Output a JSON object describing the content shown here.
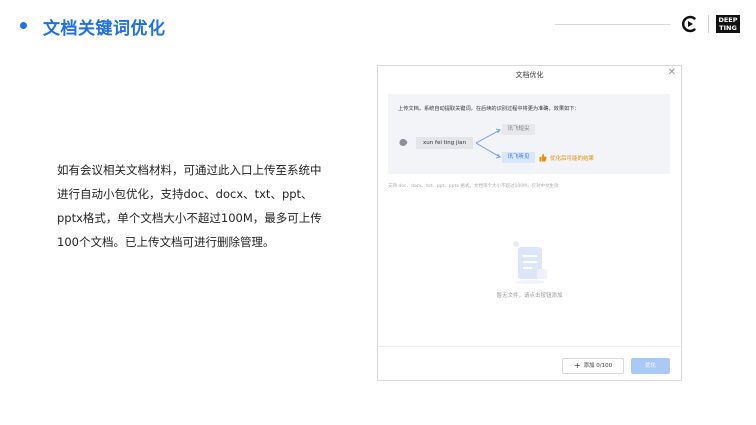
{
  "page": {
    "title": "文档关键词优化",
    "brand_logo_lines": [
      "DEEP",
      "TING"
    ]
  },
  "description": [
    "如有会议相关文档材料，可通过此入口上传至系统中",
    "进行自动小包优化，支持doc、docx、txt、ppt、",
    "pptx格式，单个文档大小不超过100M，最多可上传",
    "100个文档。已上传文档可进行删除管理。"
  ],
  "dialog": {
    "title": "文档优化",
    "close_symbol": "✕",
    "info_text": "上传文档，系统自动提取关键词，在后续的识别过程中将更为准确，效果如下：",
    "pinyin": "xun fei ting jian",
    "option_a": "讯飞短尖",
    "option_b": "讯飞听见",
    "result_note": "优化后可能的结果",
    "formats_note": "支持 doc、docx、txt、ppt、pptx 格式，文档单个大小不超过100M，仅对中文生效",
    "empty_text": "暂无文件，请点击按钮添加",
    "add_button_label": "添加 0/100",
    "confirm_button_label": "优化"
  },
  "colors": {
    "accent": "#1f6fe5",
    "note_orange": "#f08c00",
    "confirm_disabled": "#a9c9f7"
  }
}
